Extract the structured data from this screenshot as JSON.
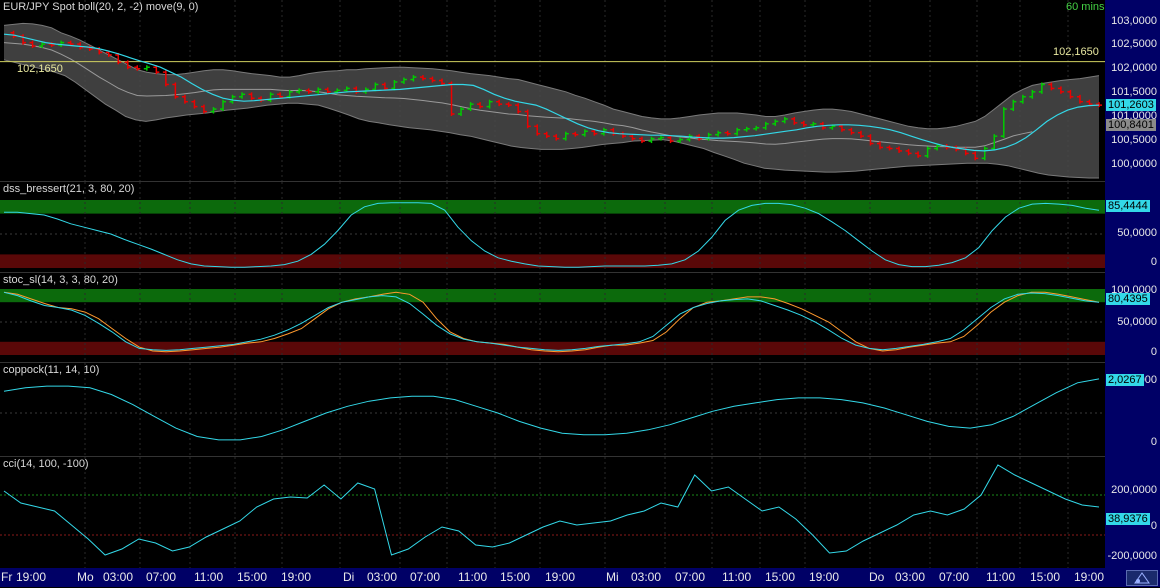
{
  "colors": {
    "background": "#000000",
    "axis_bg": "#000066",
    "candle_up": "#00cc00",
    "candle_down": "#ee0000",
    "line_cyan": "#33d8e8",
    "line_orange": "#ff9a2e",
    "band_fill": "#4a4a4a",
    "overbought": "#0c6a0c",
    "oversold": "#5a0808"
  },
  "price_panel": {
    "title": "EUR/JPY Spot boll(20, 2, -2) move(9, 0)",
    "timeframe": "60 mins",
    "ticks": [
      "103,0000",
      "102,5000",
      "102,0000",
      "101,5000",
      "101,0000",
      "100,5000",
      "100,0000"
    ],
    "level": "102,1650",
    "last_price": "101,2603",
    "mid_band": "100,8401"
  },
  "dss_panel": {
    "title": "dss_bressert(21, 3, 80, 20)",
    "ticks": [
      "50,0000",
      "0"
    ],
    "current": "85,4444"
  },
  "stoc_panel": {
    "title": "stoc_sl(14, 3, 3, 80, 20)",
    "ticks": [
      "100,0000",
      "50,0000",
      "0"
    ],
    "current": "80,4395"
  },
  "coppock_panel": {
    "title": "coppock(11, 14, 10)",
    "ticks": [
      "2,0000",
      "0"
    ],
    "current": "2,0267"
  },
  "cci_panel": {
    "title": "cci(14, 100, -100)",
    "ticks": [
      "200,0000",
      "0",
      "-200,0000"
    ],
    "current": "38,9376"
  },
  "x_axis": [
    {
      "text": "Fr",
      "day": true
    },
    {
      "text": "19:00"
    },
    {
      "text": "Mo",
      "day": true
    },
    {
      "text": "03:00"
    },
    {
      "text": "07:00"
    },
    {
      "text": "11:00"
    },
    {
      "text": "15:00"
    },
    {
      "text": "19:00"
    },
    {
      "text": "Di",
      "day": true
    },
    {
      "text": "03:00"
    },
    {
      "text": "07:00"
    },
    {
      "text": "11:00"
    },
    {
      "text": "15:00"
    },
    {
      "text": "19:00"
    },
    {
      "text": "Mi",
      "day": true
    },
    {
      "text": "03:00"
    },
    {
      "text": "07:00"
    },
    {
      "text": "11:00"
    },
    {
      "text": "15:00"
    },
    {
      "text": "19:00"
    },
    {
      "text": "Do",
      "day": true
    },
    {
      "text": "03:00"
    },
    {
      "text": "07:00"
    },
    {
      "text": "11:00"
    },
    {
      "text": "15:00"
    },
    {
      "text": "19:00"
    }
  ],
  "chart_data": [
    {
      "type": "candlestick",
      "title": "EUR/JPY Spot boll(20, 2, -2) move(9, 0)",
      "ylim": [
        99.8,
        103.05
      ],
      "close": [
        102.75,
        102.68,
        102.55,
        102.48,
        102.52,
        102.5,
        102.55,
        102.52,
        102.45,
        102.42,
        102.35,
        102.3,
        102.15,
        102.05,
        102.02,
        102.05,
        101.95,
        101.7,
        101.45,
        101.35,
        101.25,
        101.15,
        101.2,
        101.35,
        101.45,
        101.5,
        101.42,
        101.38,
        101.5,
        101.45,
        101.55,
        101.58,
        101.55,
        101.6,
        101.55,
        101.58,
        101.62,
        101.55,
        101.6,
        101.7,
        101.62,
        101.75,
        101.8,
        101.85,
        101.82,
        101.78,
        101.72,
        101.1,
        101.2,
        101.3,
        101.25,
        101.35,
        101.3,
        101.28,
        101.15,
        100.85,
        100.7,
        100.65,
        100.6,
        100.7,
        100.68,
        100.75,
        100.7,
        100.78,
        100.7,
        100.65,
        100.6,
        100.55,
        100.6,
        100.62,
        100.55,
        100.58,
        100.65,
        100.6,
        100.68,
        100.72,
        100.7,
        100.78,
        100.8,
        100.82,
        100.9,
        100.95,
        101.0,
        100.92,
        100.88,
        100.9,
        100.82,
        100.85,
        100.78,
        100.72,
        100.65,
        100.5,
        100.42,
        100.4,
        100.35,
        100.3,
        100.25,
        100.4,
        100.45,
        100.42,
        100.38,
        100.3,
        100.2,
        100.4,
        100.65,
        101.2,
        101.35,
        101.45,
        101.55,
        101.7,
        101.62,
        101.55,
        101.45,
        101.35,
        101.3,
        101.28
      ],
      "bollinger_upper": [
        102.9,
        102.92,
        102.94,
        102.93,
        102.9,
        102.85,
        102.75,
        102.68,
        102.6,
        102.5,
        102.4,
        102.3,
        102.2,
        102.1,
        102.0,
        101.95,
        101.92,
        101.9,
        101.9,
        101.92,
        101.95,
        101.98,
        102.0,
        102.0,
        101.98,
        101.95,
        101.92,
        101.9,
        101.88,
        101.85,
        101.85,
        101.88,
        101.92,
        101.95,
        101.97,
        101.98,
        102.0,
        102.0,
        102.02,
        102.03,
        102.04,
        102.05,
        102.05,
        102.04,
        102.03,
        102.02,
        102.0,
        101.98,
        101.95,
        101.92,
        101.9,
        101.88,
        101.85,
        101.82,
        101.8,
        101.75,
        101.7,
        101.65,
        101.6,
        101.55,
        101.48,
        101.42,
        101.35,
        101.28,
        101.2,
        101.15,
        101.1,
        101.05,
        101.02,
        101.0,
        101.0,
        101.02,
        101.05,
        101.08,
        101.1,
        101.12,
        101.12,
        101.12,
        101.1,
        101.08,
        101.05,
        101.05,
        101.08,
        101.12,
        101.15,
        101.18,
        101.2,
        101.2,
        101.18,
        101.15,
        101.1,
        101.05,
        101.0,
        100.95,
        100.9,
        100.85,
        100.82,
        100.8,
        100.8,
        100.82,
        100.85,
        100.9,
        100.95,
        101.05,
        101.2,
        101.35,
        101.5,
        101.6,
        101.68,
        101.72,
        101.75,
        101.78,
        101.8,
        101.82,
        101.85,
        101.88
      ],
      "bollinger_lower": [
        102.2,
        102.15,
        102.1,
        102.05,
        102.0,
        101.95,
        101.88,
        101.75,
        101.6,
        101.45,
        101.3,
        101.18,
        101.05,
        100.98,
        100.95,
        100.98,
        101.02,
        101.05,
        101.08,
        101.1,
        101.12,
        101.15,
        101.18,
        101.2,
        101.22,
        101.25,
        101.28,
        101.3,
        101.32,
        101.32,
        101.3,
        101.28,
        101.22,
        101.15,
        101.08,
        101.0,
        100.95,
        100.92,
        100.88,
        100.85,
        100.82,
        100.8,
        100.78,
        100.75,
        100.72,
        100.68,
        100.65,
        100.6,
        100.55,
        100.5,
        100.45,
        100.42,
        100.4,
        100.38,
        100.38,
        100.38,
        100.4,
        100.42,
        100.45,
        100.48,
        100.5,
        100.52,
        100.55,
        100.56,
        100.57,
        100.58,
        100.55,
        100.5,
        100.45,
        100.4,
        100.32,
        100.25,
        100.18,
        100.1,
        100.05,
        100.0,
        99.98,
        99.96,
        99.95,
        99.94,
        99.93,
        99.92,
        99.92,
        99.93,
        99.94,
        99.96,
        99.98,
        100.0,
        100.02,
        100.04,
        100.05,
        100.06,
        100.07,
        100.08,
        100.09,
        100.1,
        100.1,
        100.1,
        100.08,
        100.05,
        100.0,
        99.95,
        99.9,
        99.86,
        99.84,
        99.82,
        99.81,
        99.8,
        99.8
      ],
      "moving_average_9": [
        102.72,
        102.7,
        102.65,
        102.6,
        102.55,
        102.52,
        102.5,
        102.48,
        102.46,
        102.43,
        102.38,
        102.32,
        102.25,
        102.18,
        102.12,
        102.05,
        101.95,
        101.85,
        101.72,
        101.6,
        101.5,
        101.42,
        101.38,
        101.36,
        101.37,
        101.39,
        101.41,
        101.43,
        101.45,
        101.47,
        101.49,
        101.51,
        101.53,
        101.55,
        101.56,
        101.57,
        101.58,
        101.59,
        101.6,
        101.62,
        101.64,
        101.66,
        101.68,
        101.7,
        101.7,
        101.68,
        101.6,
        101.5,
        101.42,
        101.36,
        101.32,
        101.28,
        101.2,
        101.1,
        101.0,
        100.9,
        100.82,
        100.76,
        100.72,
        100.7,
        100.69,
        100.68,
        100.67,
        100.67,
        100.66,
        100.65,
        100.63,
        100.62,
        100.61,
        100.61,
        100.62,
        100.64,
        100.66,
        100.69,
        100.72,
        100.75,
        100.78,
        100.82,
        100.85,
        100.87,
        100.88,
        100.88,
        100.87,
        100.85,
        100.82,
        100.78,
        100.72,
        100.65,
        100.58,
        100.52,
        100.46,
        100.42,
        100.39,
        100.36,
        100.35,
        100.37,
        100.42,
        100.5,
        100.62,
        100.78,
        100.95,
        101.08,
        101.18,
        101.24,
        101.27,
        101.28
      ]
    },
    {
      "type": "line",
      "title": "dss_bressert(21, 3, 80, 20)",
      "ylim": [
        0,
        100
      ],
      "bands": {
        "overbought": 80,
        "oversold": 20
      },
      "series": [
        {
          "values": [
            82,
            82,
            80,
            78,
            72,
            65,
            60,
            55,
            50,
            42,
            35,
            28,
            20,
            12,
            6,
            3,
            2,
            1,
            1,
            2,
            3,
            5,
            10,
            20,
            35,
            55,
            78,
            90,
            95,
            96,
            96,
            96,
            95,
            85,
            60,
            40,
            25,
            15,
            10,
            6,
            3,
            2,
            1,
            1,
            2,
            3,
            3,
            3,
            3,
            4,
            6,
            12,
            25,
            45,
            70,
            85,
            92,
            95,
            95,
            93,
            88,
            80,
            68,
            55,
            40,
            25,
            12,
            5,
            2,
            2,
            4,
            8,
            15,
            30,
            55,
            75,
            88,
            94,
            95,
            94,
            92,
            88,
            85
          ]
        }
      ]
    },
    {
      "type": "line",
      "title": "stoc_sl(14, 3, 3, 80, 20)",
      "ylim": [
        0,
        100
      ],
      "bands": {
        "overbought": 80,
        "oversold": 20
      },
      "series": [
        {
          "values": [
            95,
            92,
            85,
            78,
            72,
            70,
            65,
            55,
            40,
            25,
            12,
            6,
            5,
            6,
            8,
            10,
            12,
            15,
            18,
            20,
            25,
            32,
            40,
            55,
            70,
            80,
            85,
            88,
            92,
            95,
            92,
            80,
            55,
            35,
            25,
            20,
            18,
            16,
            12,
            8,
            6,
            5,
            6,
            8,
            12,
            15,
            15,
            18,
            22,
            35,
            55,
            72,
            80,
            82,
            85,
            88,
            88,
            85,
            78,
            70,
            60,
            50,
            35,
            20,
            10,
            6,
            8,
            12,
            15,
            18,
            20,
            28,
            45,
            65,
            80,
            90,
            95,
            95,
            92,
            88,
            84,
            80
          ]
        },
        {
          "values": [
            95,
            90,
            82,
            75,
            72,
            68,
            60,
            48,
            35,
            20,
            10,
            8,
            7,
            8,
            10,
            12,
            14,
            16,
            20,
            24,
            30,
            38,
            48,
            60,
            72,
            80,
            84,
            88,
            90,
            88,
            78,
            62,
            45,
            32,
            24,
            20,
            18,
            15,
            12,
            10,
            8,
            7,
            8,
            10,
            13,
            15,
            17,
            20,
            28,
            45,
            62,
            72,
            78,
            82,
            84,
            85,
            82,
            75,
            68,
            60,
            50,
            38,
            25,
            15,
            10,
            8,
            10,
            13,
            16,
            20,
            25,
            38,
            55,
            72,
            85,
            92,
            94,
            93,
            90,
            86,
            82,
            80
          ]
        }
      ]
    },
    {
      "type": "line",
      "title": "coppock(11, 14, 10)",
      "ylim": [
        -2.5,
        2.5
      ],
      "series": [
        {
          "values": [
            1.3,
            1.5,
            1.6,
            1.6,
            1.5,
            1.1,
            0.5,
            -0.2,
            -0.9,
            -1.4,
            -1.6,
            -1.6,
            -1.4,
            -1.0,
            -0.5,
            0.0,
            0.4,
            0.7,
            0.9,
            1.0,
            1.0,
            0.8,
            0.4,
            0.0,
            -0.5,
            -0.9,
            -1.2,
            -1.3,
            -1.3,
            -1.2,
            -1.0,
            -0.7,
            -0.3,
            0.1,
            0.4,
            0.6,
            0.8,
            0.9,
            0.9,
            0.8,
            0.6,
            0.3,
            -0.1,
            -0.5,
            -0.8,
            -0.9,
            -0.7,
            -0.2,
            0.5,
            1.2,
            1.8,
            2.03
          ]
        }
      ]
    },
    {
      "type": "line",
      "title": "cci(14, 100, -100)",
      "ylim": [
        -250,
        250
      ],
      "bands": {
        "upper": 100,
        "lower": -100
      },
      "series": [
        {
          "values": [
            120,
            60,
            40,
            20,
            -50,
            -120,
            -200,
            -170,
            -120,
            -140,
            -180,
            -160,
            -110,
            -70,
            -30,
            40,
            80,
            90,
            85,
            150,
            80,
            160,
            130,
            -200,
            -170,
            -110,
            -60,
            -80,
            -150,
            -160,
            -140,
            -100,
            -60,
            -30,
            -50,
            -40,
            -30,
            0,
            20,
            60,
            40,
            200,
            120,
            140,
            80,
            20,
            40,
            -20,
            -100,
            -190,
            -180,
            -130,
            -90,
            -50,
            0,
            20,
            0,
            30,
            100,
            250,
            200,
            160,
            120,
            80,
            50,
            40
          ]
        }
      ]
    }
  ]
}
